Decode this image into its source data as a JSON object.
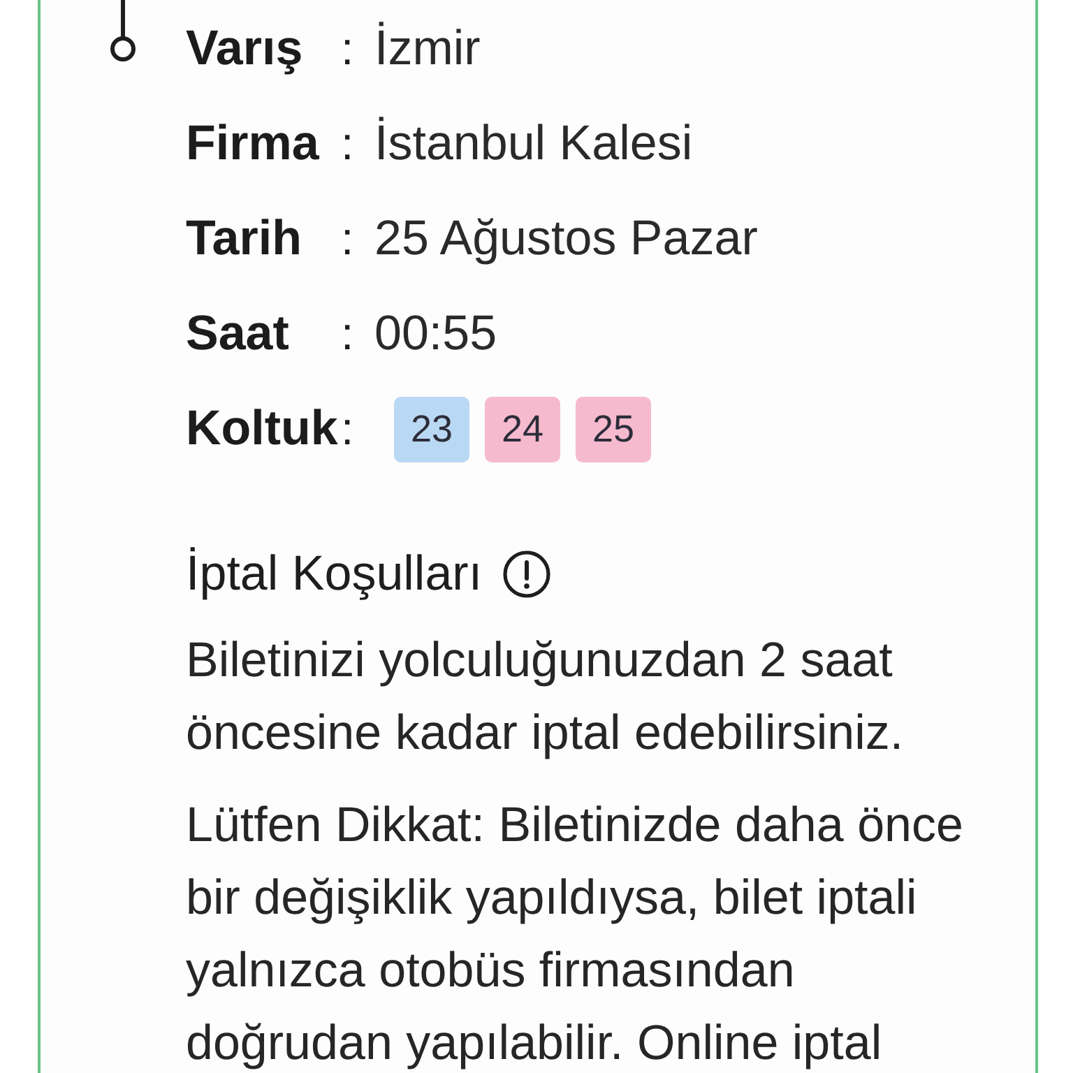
{
  "trip_details": {
    "rows": [
      {
        "kind": "text",
        "label": "Varış",
        "separator": ":",
        "value": "İzmir"
      },
      {
        "kind": "text",
        "label": "Firma",
        "separator": ":",
        "value": "İstanbul Kalesi"
      },
      {
        "kind": "text",
        "label": "Tarih",
        "separator": ":",
        "value": "25 Ağustos Pazar"
      },
      {
        "kind": "text",
        "label": "Saat",
        "separator": ":",
        "value": "00:55"
      },
      {
        "kind": "seats",
        "label": "Koltuk",
        "separator": ":",
        "seats": [
          {
            "number": "23",
            "color": "#b9d8f3"
          },
          {
            "number": "24",
            "color": "#f6bace"
          },
          {
            "number": "25",
            "color": "#f6bace"
          }
        ]
      }
    ]
  },
  "cancellation": {
    "title": "İptal Koşulları",
    "paragraphs": [
      "Biletinizi yolculuğunuzdan 2 saat öncesine kadar iptal edebilirsiniz.",
      "Lütfen Dikkat: Biletinizde daha önce bir değişiklik yapıldıysa, bilet iptali yalnızca otobüs firmasından doğrudan yapılabilir. Online iptal"
    ]
  }
}
